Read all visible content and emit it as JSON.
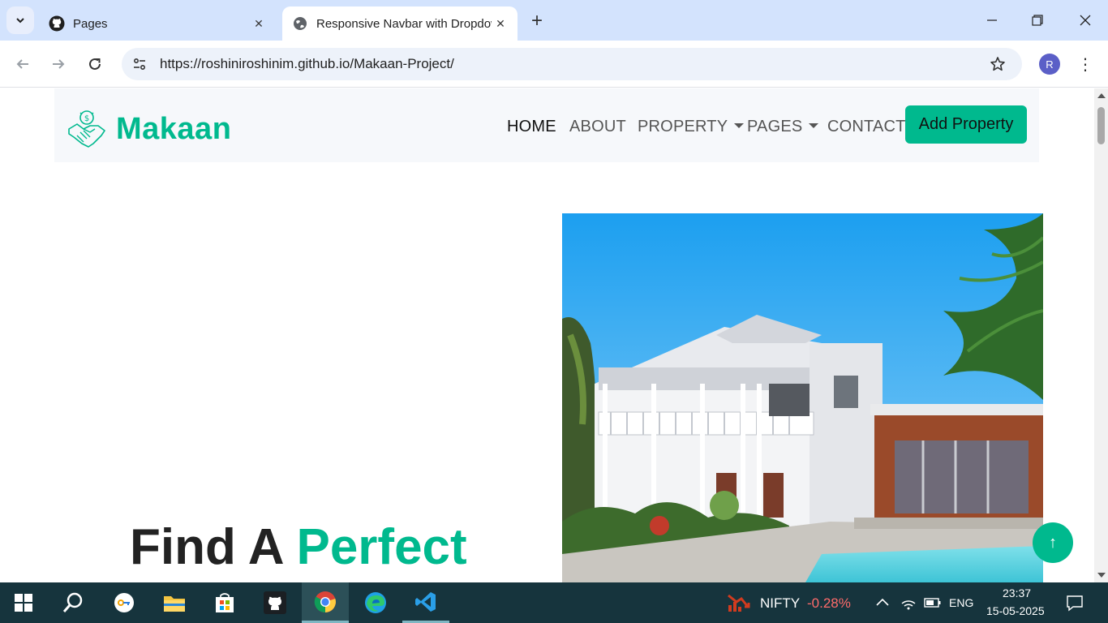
{
  "browser": {
    "tabs": [
      {
        "title": "Pages",
        "active": false
      },
      {
        "title": "Responsive Navbar with Dropdown",
        "active": true
      }
    ],
    "url": "https://roshiniroshinim.github.io/Makaan-Project/",
    "profile_initial": "R"
  },
  "site": {
    "brand": "Makaan",
    "nav": {
      "home": "HOME",
      "about": "ABOUT",
      "property": "PROPERTY",
      "pages": "PAGES",
      "contact": "CONTACT"
    },
    "add_property_label": "Add Property",
    "hero": {
      "title_part1": "Find A ",
      "title_part2": "Perfect"
    },
    "back_to_top_icon": "↑",
    "accent_color": "#00b98e"
  },
  "taskbar": {
    "ticker_name": "NIFTY",
    "ticker_change": "-0.28%",
    "language": "ENG",
    "time": "23:37",
    "date": "15-05-2025"
  }
}
